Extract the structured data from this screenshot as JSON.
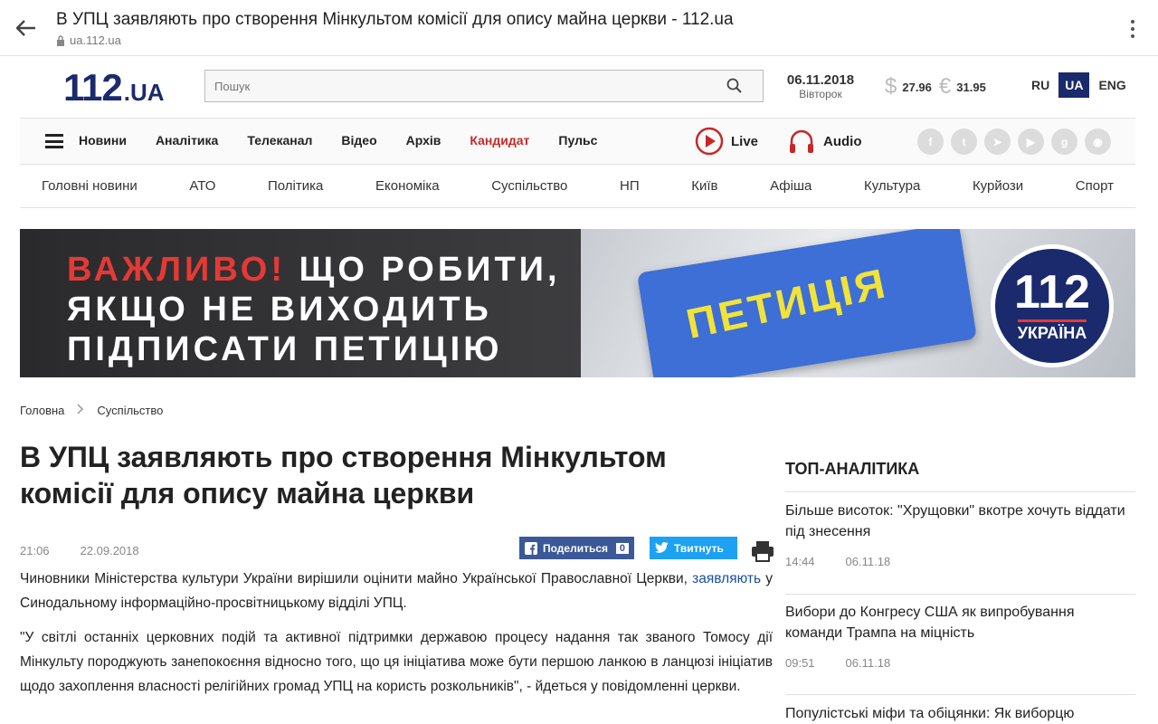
{
  "browser": {
    "title": "В УПЦ заявляють про створення Мінкультом комісії для опису майна церкви - 112.ua",
    "url": "ua.112.ua"
  },
  "site": {
    "logo_main": "112",
    "logo_suffix": ".UA",
    "search_placeholder": "Пошук",
    "date": "06.11.2018",
    "weekday": "Вівторок",
    "usd_symbol": "$",
    "usd_rate": "27.96",
    "eur_symbol": "€",
    "eur_rate": "31.95",
    "langs": [
      "RU",
      "UA",
      "ENG"
    ]
  },
  "nav": {
    "items": [
      "Новини",
      "Аналітика",
      "Телеканал",
      "Відео",
      "Архів",
      "Кандидат",
      "Пульс"
    ],
    "live": "Live",
    "audio": "Audio",
    "highlight_color": "#c62828"
  },
  "subnav": [
    "Головні новини",
    "АТО",
    "Політика",
    "Економіка",
    "Суспільство",
    "НП",
    "Київ",
    "Афіша",
    "Культура",
    "Курйози",
    "Спорт"
  ],
  "banner": {
    "line1_red": "ВАЖЛИВО!",
    "line1_rest": " ЩО РОБИТИ,",
    "line2": "ЯКЩО НЕ ВИХОДИТЬ",
    "line3": "ПІДПИСАТИ ПЕТИЦІЮ",
    "key_text": "ПЕТИЦІЯ",
    "badge_num": "112",
    "badge_text": "УКРАЇНА"
  },
  "breadcrumb": [
    "Головна",
    "Суспільство"
  ],
  "article": {
    "title": "В УПЦ заявляють про створення Мінкультом комісії для опису майна церкви",
    "time": "21:06",
    "date": "22.09.2018",
    "fb_label": "Поделиться",
    "fb_count": "0",
    "tw_label": "Твитнуть",
    "p1_before": "Чиновники Міністерства культури України вирішили оцінити майно Української Православної Церкви, ",
    "p1_link": "заявляють",
    "p1_after": " у Синодальному інформаційно-просвітницькому відділі УПЦ.",
    "p2": "\"У світлі останніх церковних подій та активної підтримки державою процесу надання так званого Томосу дії Мінкульту породжують занепокоєння відносно того, що ця ініціатива може бути першою ланкою в ланцюзі ініціатив щодо захоплення власності релігійних громад УПЦ на користь розкольників\", - йдеться у повідомленні церкви."
  },
  "sidebar": {
    "title": "ТОП-АНАЛІТИКА",
    "items": [
      {
        "title": "Більше висоток: \"Хрущовки\" вкотре хочуть віддати під знесення",
        "time": "14:44",
        "date": "06.11.18"
      },
      {
        "title": "Вибори до Конгресу США як випробування команди Трампа на міцність",
        "time": "09:51",
        "date": "06.11.18"
      },
      {
        "title": "Популістські міфи та обіцянки: Як виборцю",
        "time": "",
        "date": ""
      }
    ]
  }
}
